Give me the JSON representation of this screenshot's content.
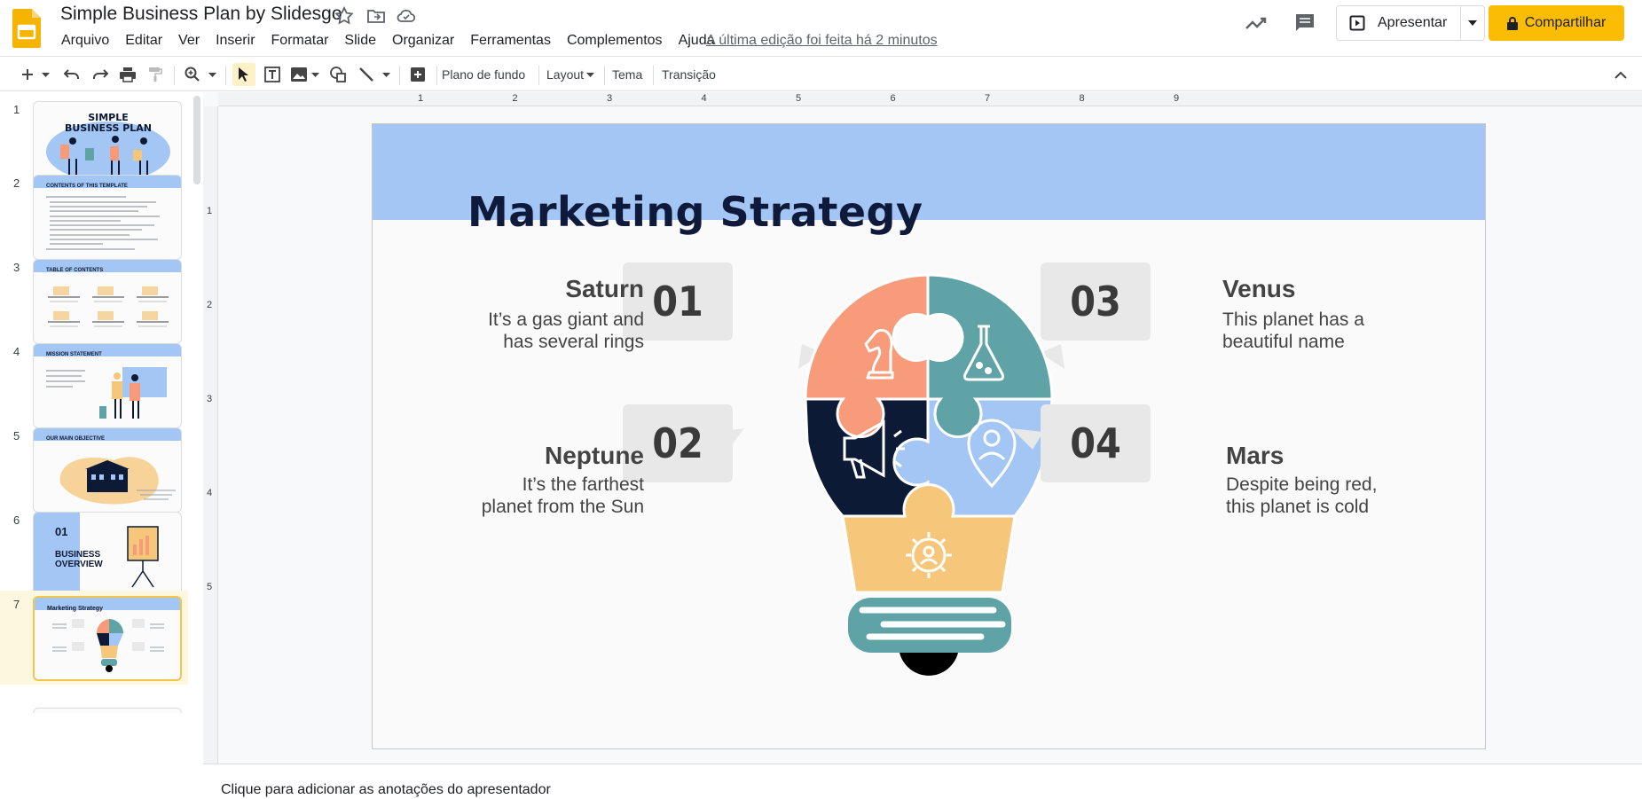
{
  "header": {
    "title": "Simple Business Plan by Slidesgo",
    "last_edit": "A última edição foi feita há 2 minutos",
    "present_label": "Apresentar",
    "share_label": "Compartilhar"
  },
  "menu": [
    "Arquivo",
    "Editar",
    "Ver",
    "Inserir",
    "Formatar",
    "Slide",
    "Organizar",
    "Ferramentas",
    "Complementos",
    "Ajuda"
  ],
  "toolbar": {
    "background_label": "Plano de fundo",
    "layout_label": "Layout",
    "theme_label": "Tema",
    "transition_label": "Transição"
  },
  "ruler": {
    "h": [
      "1",
      "2",
      "3",
      "4",
      "5",
      "6",
      "7",
      "8",
      "9"
    ],
    "v": [
      "1",
      "2",
      "3",
      "4",
      "5"
    ]
  },
  "filmstrip": {
    "numbers": [
      "1",
      "2",
      "3",
      "4",
      "5",
      "6",
      "7"
    ],
    "thumbs": {
      "t1_title_a": "SIMPLE",
      "t1_title_b": "BUSINESS PLAN",
      "t2_title": "CONTENTS OF THIS TEMPLATE",
      "t3_title": "TABLE OF CONTENTS",
      "t4_title": "MISSION STATEMENT",
      "t5_title": "OUR MAIN OBJECTIVE",
      "t6_num": "01",
      "t6_title_a": "BUSINESS",
      "t6_title_b": "OVERVIEW",
      "t7_title": "Marketing Strategy"
    },
    "selected_index": 7
  },
  "slide": {
    "title": "Marketing Strategy",
    "items": [
      {
        "num": "01",
        "title": "Saturn",
        "desc_1": "It’s a gas giant and",
        "desc_2": "has several rings"
      },
      {
        "num": "02",
        "title": "Neptune",
        "desc_1": "It’s the farthest",
        "desc_2": "planet from the Sun"
      },
      {
        "num": "03",
        "title": "Venus",
        "desc_1": "This planet has a",
        "desc_2": "beautiful name"
      },
      {
        "num": "04",
        "title": "Mars",
        "desc_1": "Despite being red,",
        "desc_2": "this planet is cold"
      }
    ]
  },
  "colors": {
    "band": "#a3c6f4",
    "puzzle_orange": "#f79b7a",
    "puzzle_teal": "#5fa3a6",
    "puzzle_navy": "#0c1a35",
    "puzzle_blue": "#a3c6f4",
    "puzzle_yellow": "#f6c67a",
    "share_yellow": "#fbbc04"
  },
  "notes": {
    "placeholder": "Clique para adicionar as anotações do apresentador"
  }
}
